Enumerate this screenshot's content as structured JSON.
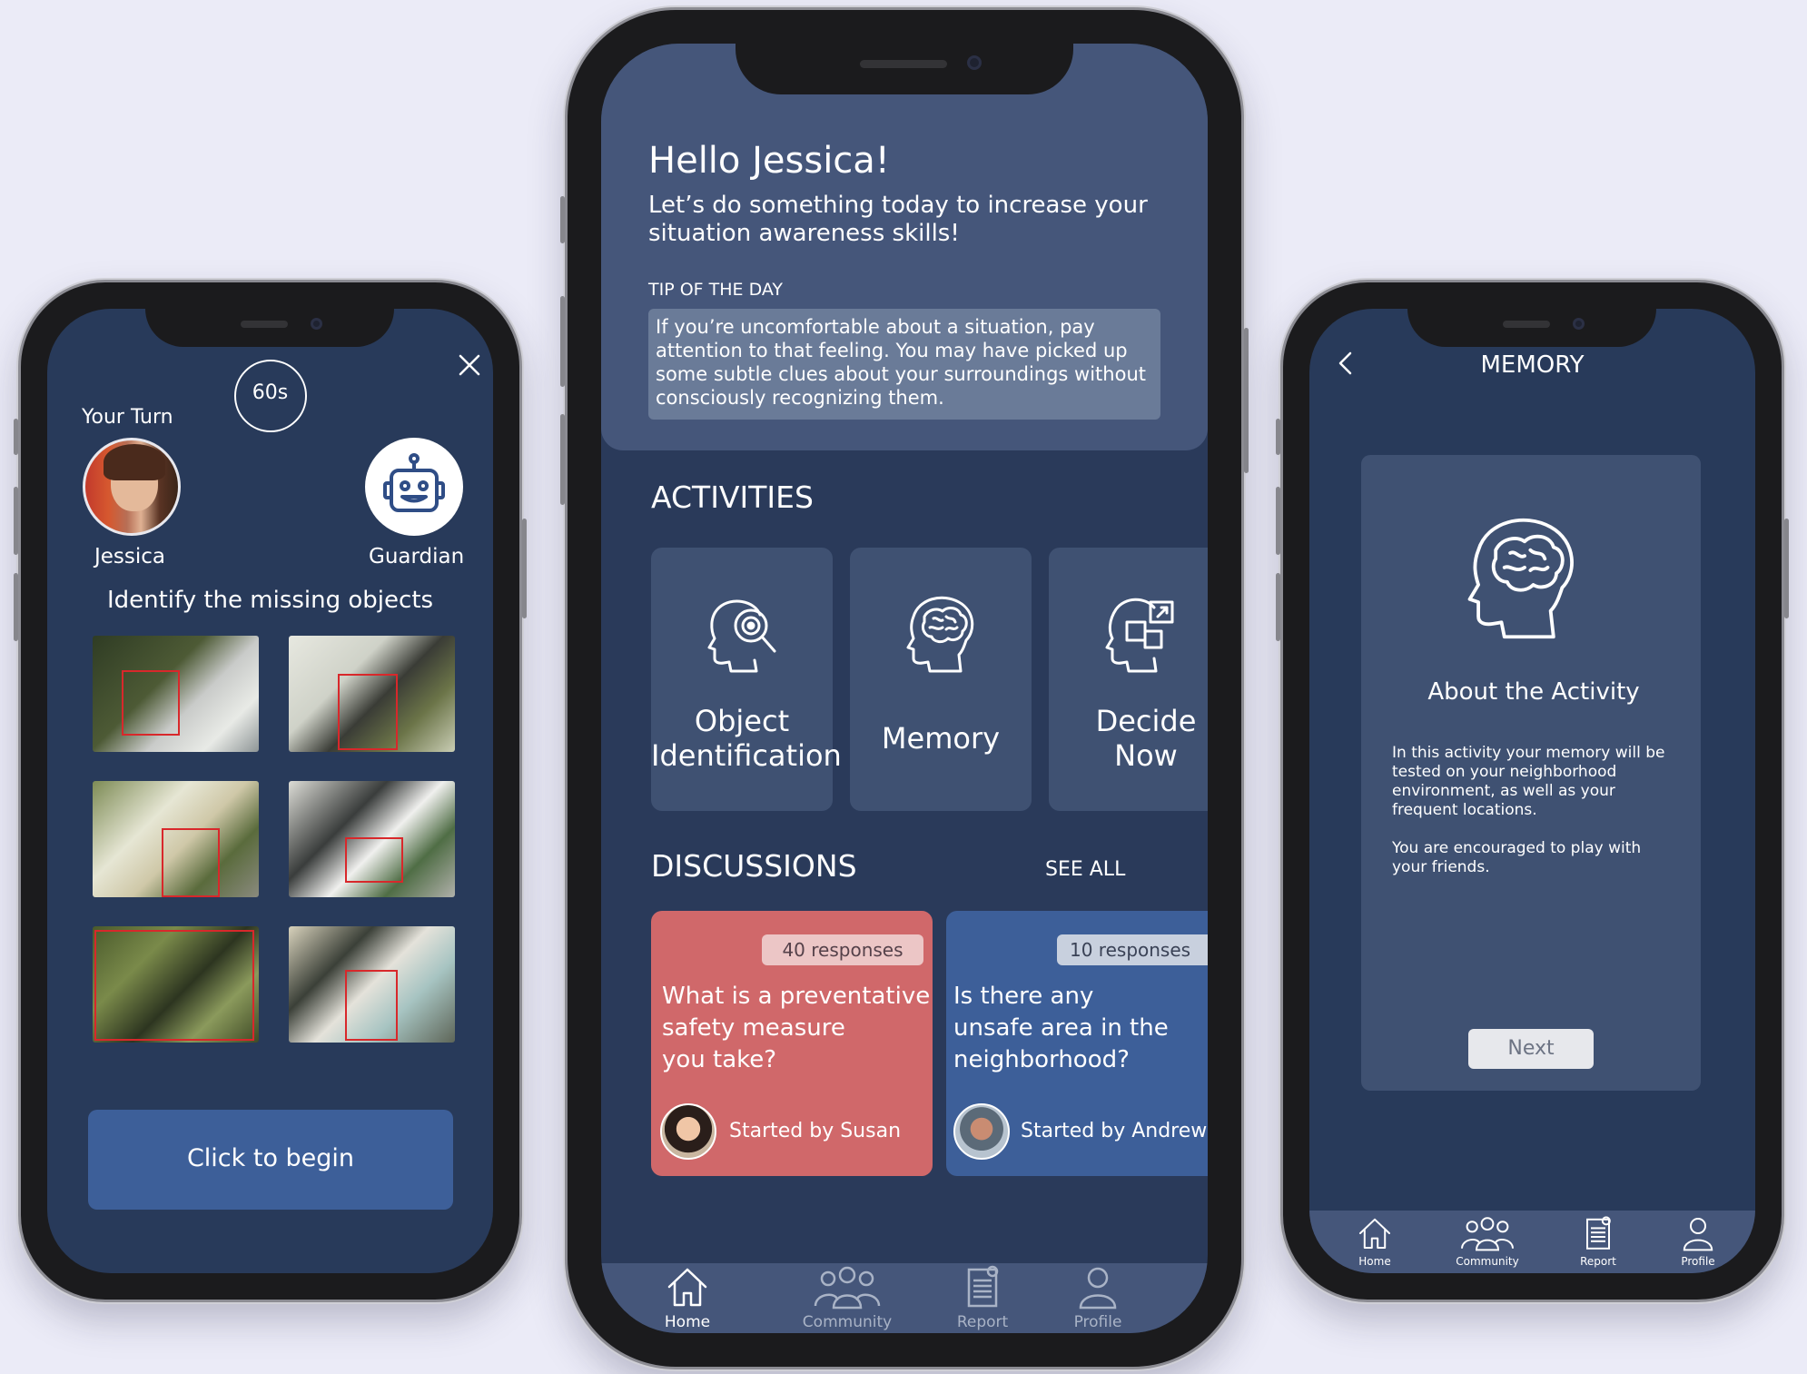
{
  "left_screen": {
    "timer": "60s",
    "your_turn_label": "Your Turn",
    "player_name": "Jessica",
    "opponent_name": "Guardian",
    "instruction": "Identify the missing objects",
    "begin_button": "Click to begin"
  },
  "center_screen": {
    "greeting": "Hello Jessica!",
    "subtitle_line1": "Let’s do something today to increase your",
    "subtitle_line2": "situation awareness skills!",
    "tip_heading": "TIP OF THE DAY",
    "tip_lines": [
      "If you’re uncomfortable about a situation, pay",
      "attention to that feeling. You may have picked up",
      "some subtle clues about your surroundings without",
      "consciously recognizing them."
    ],
    "activities_heading": "ACTIVITIES",
    "activities": [
      {
        "line1": "Object",
        "line2": "Identification",
        "icon": "head-magnifier-icon"
      },
      {
        "line1": "Memory",
        "line2": "",
        "icon": "head-brain-icon"
      },
      {
        "line1": "Decide",
        "line2": "Now",
        "icon": "head-puzzle-icon"
      }
    ],
    "discussions_heading": "DISCUSSIONS",
    "see_all": "SEE ALL",
    "discussions": [
      {
        "responses": "40 responses",
        "q1": "What is a preventative",
        "q2": "safety measure",
        "q3": " you take?",
        "starter": "Started by Susan",
        "color": "#d0686a"
      },
      {
        "responses": "10 responses",
        "q1": "Is there any",
        "q2": "unsafe area in the",
        "q3": "neighborhood?",
        "starter": "Started by Andrew",
        "color": "#3d5f99"
      }
    ],
    "nav": {
      "home": "Home",
      "community": "Community",
      "report": "Report",
      "profile": "Profile"
    }
  },
  "right_screen": {
    "title": "MEMORY",
    "about_heading": "About the Activity",
    "desc_lines": [
      "In this activity your memory will be",
      "tested on your neighborhood",
      "environment, as well as your",
      "frequent locations."
    ],
    "desc2_lines": [
      "You are encouraged to play with",
      "your friends."
    ],
    "next_button": "Next",
    "nav": {
      "home": "Home",
      "community": "Community",
      "report": "Report",
      "profile": "Profile"
    }
  },
  "colors": {
    "background": "#ebebf7",
    "screen": "#2a3a5a",
    "card": "#3f5172",
    "accent_blue": "#3d5f99",
    "accent_red": "#d0686a"
  }
}
